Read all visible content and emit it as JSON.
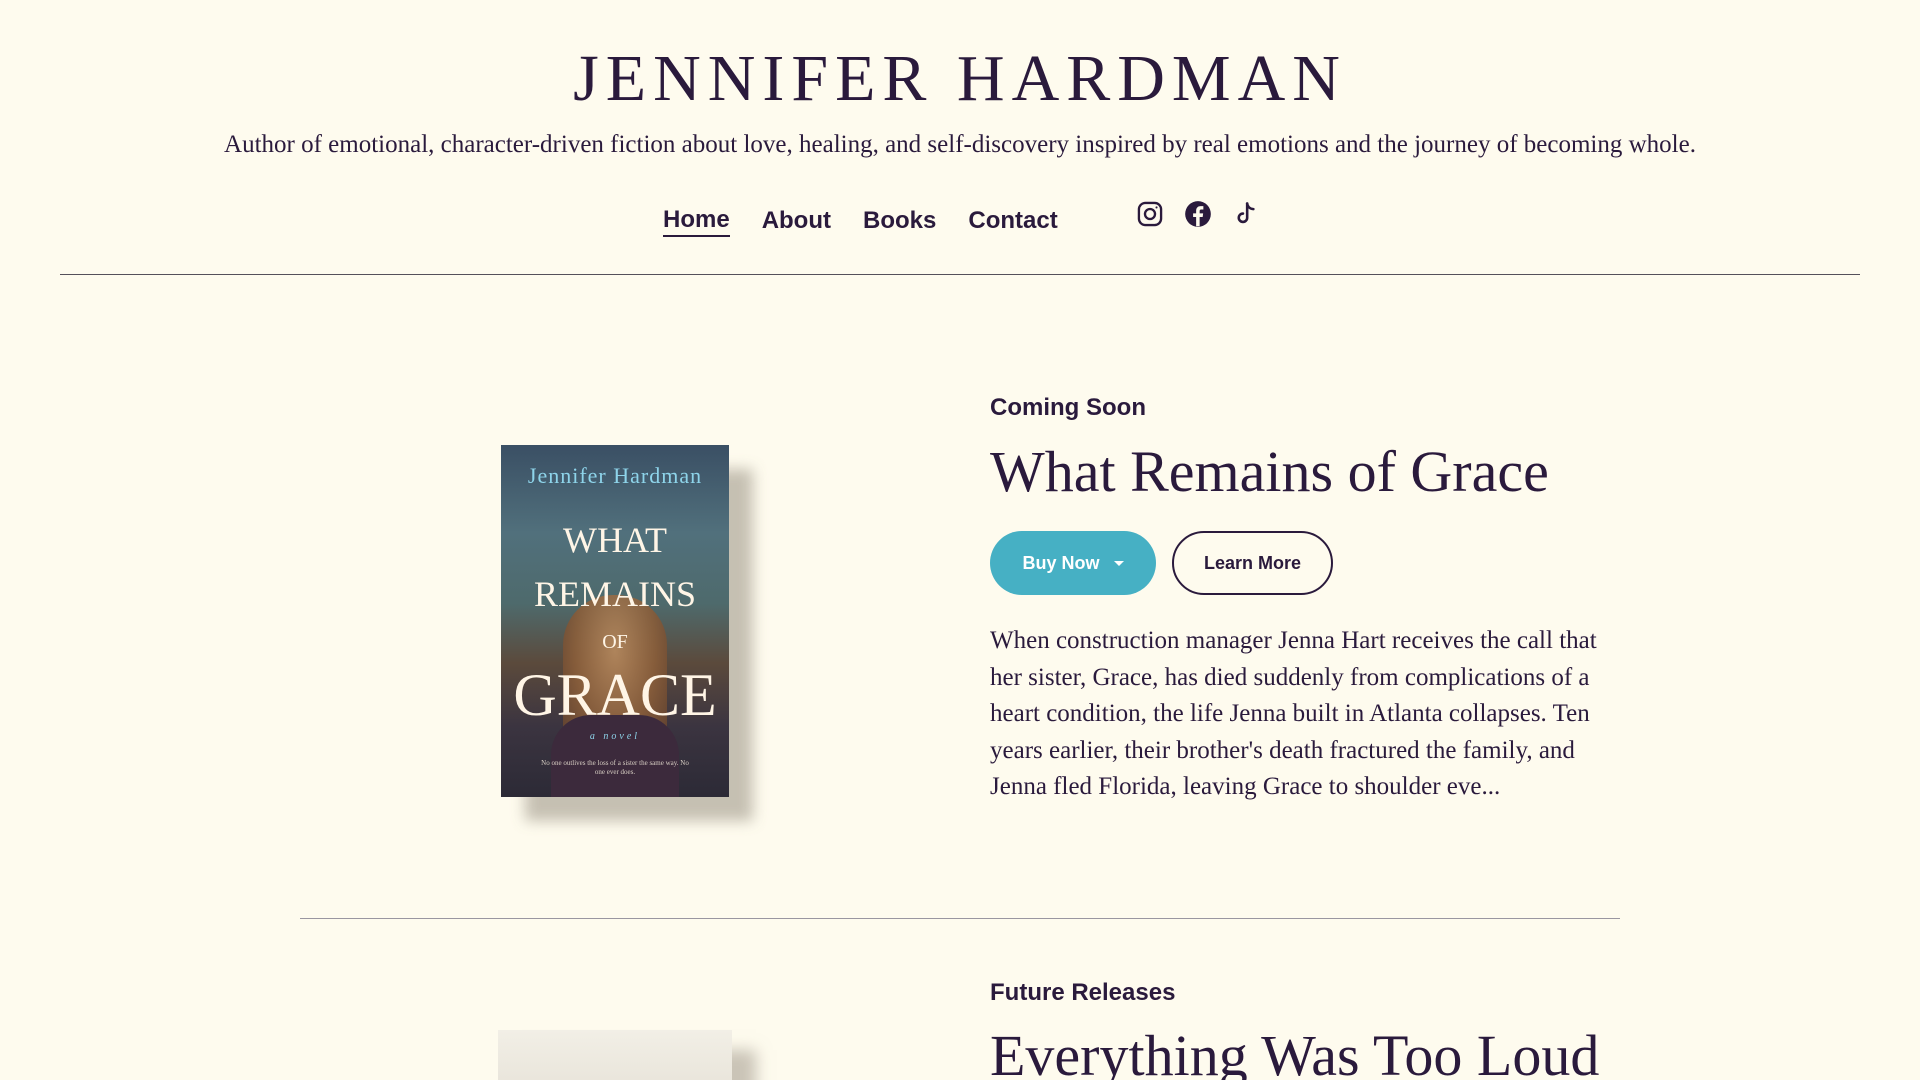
{
  "site": {
    "title": "JENNIFER HARDMAN",
    "tagline": "Author of emotional, character-driven fiction about love, healing, and self-discovery inspired by real emotions and the journey of becoming whole."
  },
  "nav": {
    "items": [
      {
        "label": "Home",
        "active": true
      },
      {
        "label": "About",
        "active": false
      },
      {
        "label": "Books",
        "active": false
      },
      {
        "label": "Contact",
        "active": false
      }
    ]
  },
  "socials": [
    "instagram-icon",
    "facebook-icon",
    "tiktok-icon"
  ],
  "colors": {
    "background": "#fefbee",
    "text": "#2a1a3c",
    "accent": "#46b0c4"
  },
  "books": [
    {
      "label": "Coming Soon",
      "title": "What Remains of Grace",
      "buy_label": "Buy Now",
      "learn_label": "Learn More",
      "description": "When construction manager Jenna Hart receives the call that her sister, Grace, has died suddenly from complications of a heart condition, the life Jenna built in Atlanta collapses. Ten years earlier, their brother's death fractured the family, and Jenna fled Florida, leaving Grace to shoulder eve...",
      "cover": {
        "author": "Jennifer Hardman",
        "line1": "WHAT",
        "line2": "REMAINS",
        "line3": "OF",
        "line4": "GRACE",
        "subtitle": "a novel",
        "blurb": "No one outlives the loss of a sister the same way. No one ever does."
      }
    },
    {
      "label": "Future Releases",
      "title": "Everything Was Too Loud"
    }
  ]
}
